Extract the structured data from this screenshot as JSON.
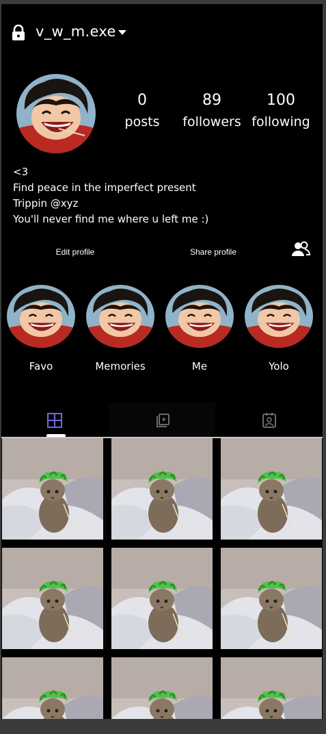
{
  "header": {
    "username": "v_w_m.exe"
  },
  "stats": {
    "posts": {
      "count": "0",
      "label": "posts"
    },
    "followers": {
      "count": "89",
      "label": "followers"
    },
    "following": {
      "count": "100",
      "label": "following"
    }
  },
  "bio": {
    "lines": [
      "<3",
      "Find peace in the imperfect present",
      "Trippin @xyz",
      "You'll never find me where u left me :)"
    ]
  },
  "actions": {
    "edit_profile": "Edit profile",
    "share_profile": "Share profile"
  },
  "highlights": [
    {
      "name": "Favo"
    },
    {
      "name": "Memories"
    },
    {
      "name": "Me"
    },
    {
      "name": "Yolo"
    }
  ],
  "tabs": [
    {
      "icon": "grid-icon",
      "active": true
    },
    {
      "icon": "reels-icon",
      "active": false
    },
    {
      "icon": "tagged-icon",
      "active": false
    }
  ],
  "colors": {
    "background": "#000000",
    "text": "#ffffff",
    "active_tab_icon": "#6b6bd6",
    "inactive_tab_icon": "#8a8a8a"
  }
}
